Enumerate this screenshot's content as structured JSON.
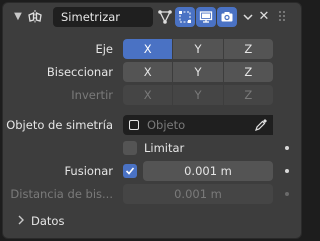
{
  "header": {
    "modifier_name": "Simetrizar",
    "icons": [
      "chevron-down-icon",
      "mirror-modifier-icon",
      "vertex-edit-mode-icon",
      "on-cage-icon",
      "realtime-display-icon",
      "render-camera-icon",
      "dropdown-chevron-icon",
      "close-icon",
      "drag-handle-icon"
    ]
  },
  "rows": {
    "eje": {
      "label": "Eje",
      "options": [
        "X",
        "Y",
        "Z"
      ],
      "active": [
        "X"
      ]
    },
    "biseccionar": {
      "label": "Biseccionar",
      "options": [
        "X",
        "Y",
        "Z"
      ],
      "active": []
    },
    "invertir": {
      "label": "Invertir",
      "options": [
        "X",
        "Y",
        "Z"
      ],
      "active": [],
      "disabled": true
    }
  },
  "mirror_object": {
    "label": "Objeto de simetría",
    "placeholder": "Objeto"
  },
  "limitar": {
    "label": "Limitar",
    "checked": false
  },
  "fusionar": {
    "label": "Fusionar",
    "checked": true,
    "value": "0.001 m"
  },
  "distancia": {
    "label": "Distancia de bis...",
    "value": "0.001 m",
    "disabled": true
  },
  "subpanel": {
    "label": "Datos",
    "expanded": false
  },
  "colors": {
    "accent": "#4a72c4",
    "panel": "#3d3d3d",
    "field": "#545454",
    "dark_field": "#1f1f1f"
  }
}
